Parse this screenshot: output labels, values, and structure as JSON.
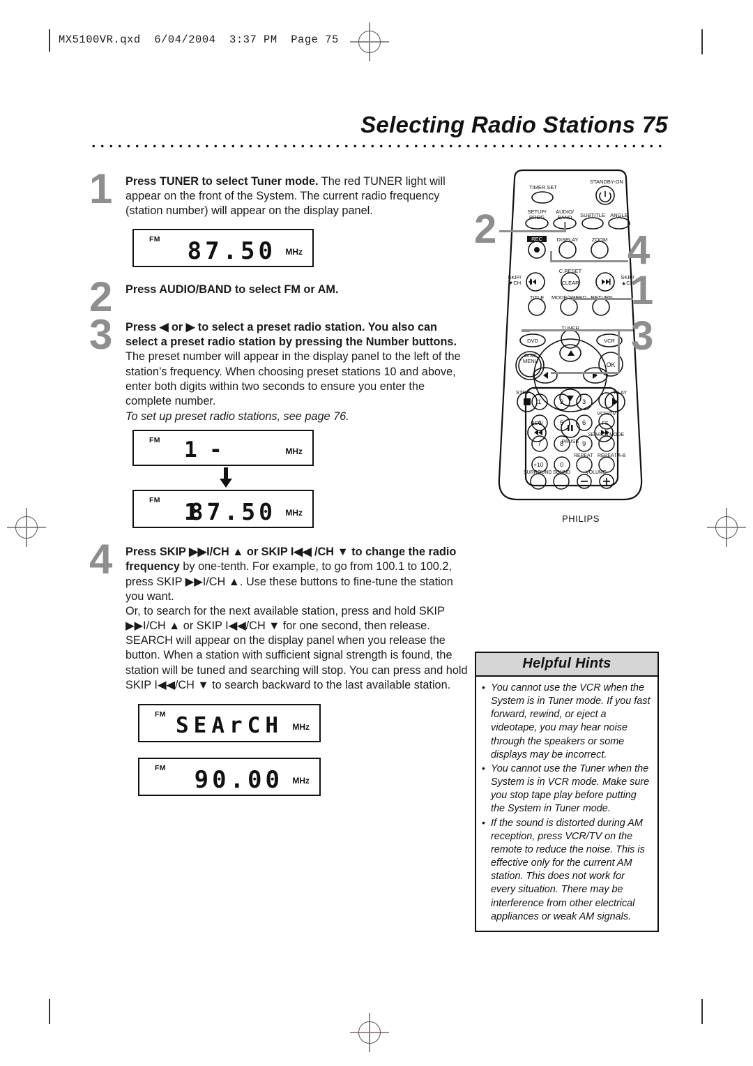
{
  "header": {
    "file_line": "MX5100VR.qxd  6/04/2004  3:37 PM  Page 75"
  },
  "title": {
    "text": "Selecting Radio Stations  75"
  },
  "steps": [
    {
      "num": "1",
      "bold": "Press TUNER to select Tuner mode.",
      "rest": " The red TUNER light will appear on the front of the System. The current radio frequency (station number) will appear on the display panel."
    },
    {
      "num": "2",
      "bold": "Press AUDIO/BAND to select FM or AM.",
      "rest": ""
    },
    {
      "num": "3",
      "bold": "Press ◀ or ▶ to select a preset radio station. You also can select a preset radio station by pressing the Number buttons.",
      "rest": " The preset number will appear in the display panel to the left of the station’s frequency. When choosing preset stations 10 and above, enter both digits within two seconds to ensure you enter the complete number.",
      "italic_note": "To set up preset radio stations, see page 76."
    },
    {
      "num": "4",
      "bold": "Press SKIP ▶▶I/CH ▲ or SKIP I◀◀ /CH ▼ to change the radio frequency",
      "rest": " by one-tenth. For example, to go from 100.1 to 100.2, press SKIP ▶▶I/CH ▲. Use these buttons to fine-tune the station you want.",
      "rest2": "Or, to search for the next available station, press and hold SKIP ▶▶I/CH ▲ or SKIP I◀◀/CH ▼ for one second, then release. SEARCH will appear on the display panel when you release the button. When a station with sufficient signal strength is found, the station will be tuned and searching will stop. You can press and hold SKIP I◀◀/CH ▼ to search backward to the last available station."
    }
  ],
  "displays": [
    {
      "id": "display-1",
      "band": "FM",
      "preset": "",
      "value": "87.50",
      "unit": "MHz"
    },
    {
      "id": "display-2",
      "band": "FM",
      "preset": "1",
      "value": "-",
      "unit": "MHz"
    },
    {
      "id": "display-3",
      "band": "FM",
      "preset": "1",
      "value": "87.50",
      "unit": "MHz"
    },
    {
      "id": "display-4",
      "band": "FM",
      "preset": "",
      "value": "SEArCH",
      "unit": "MHz"
    },
    {
      "id": "display-5",
      "band": "FM",
      "preset": "",
      "value": "90.00",
      "unit": "MHz"
    }
  ],
  "hints": {
    "caption": "Helpful Hints",
    "items": [
      "You cannot use the VCR when the System is in Tuner mode. If you fast forward, rewind, or eject a videotape, you may hear noise through the speakers or some displays may be incorrect.",
      "You cannot use the Tuner when the System is in VCR mode. Make sure you stop tape play before putting the System in Tuner mode.",
      "If the sound is distorted during AM reception, press VCR/TV on the remote to reduce the noise. This is effective only for the current AM station. This does not work for every situation. There may be interference from other electrical appliances or weak AM signals."
    ]
  },
  "remote": {
    "brand": "PHILIPS",
    "callouts": [
      {
        "label": "2",
        "target": "audio-band-button"
      },
      {
        "label": "4",
        "target": "skip-forward-button"
      },
      {
        "label": "1",
        "target": "tuner-button"
      },
      {
        "label": "3",
        "target": "arrow-left-right-buttons"
      }
    ],
    "buttons": [
      {
        "label": "TIMER SET"
      },
      {
        "label": "STANDBY-ON"
      },
      {
        "label": "SETUP/ PROG"
      },
      {
        "label": "AUDIO/ BAND"
      },
      {
        "label": "SUBTITLE"
      },
      {
        "label": "ANGLE"
      },
      {
        "label": "REC"
      },
      {
        "label": "DISPLAY"
      },
      {
        "label": "ZOOM"
      },
      {
        "label": "SKIP/ ▼CH"
      },
      {
        "label": "C.RESET"
      },
      {
        "label": "CLEAR"
      },
      {
        "label": "SKIP/ ▲CH"
      },
      {
        "label": "TITLE"
      },
      {
        "label": "MODE/SPEED"
      },
      {
        "label": "RETURN"
      },
      {
        "label": "TUNER"
      },
      {
        "label": "DVD"
      },
      {
        "label": "VCR"
      },
      {
        "label": "DISC MENU"
      },
      {
        "label": "OK"
      },
      {
        "label": "STOP"
      },
      {
        "label": "PLAY"
      },
      {
        "label": "REW"
      },
      {
        "label": "PAUSE"
      },
      {
        "label": "FF"
      },
      {
        "label": "1"
      },
      {
        "label": "2"
      },
      {
        "label": "3"
      },
      {
        "label": "4"
      },
      {
        "label": "5"
      },
      {
        "label": "6"
      },
      {
        "label": "7"
      },
      {
        "label": "8"
      },
      {
        "label": "9"
      },
      {
        "label": "+10"
      },
      {
        "label": "0"
      },
      {
        "label": "VCR/TV"
      },
      {
        "label": "SEARCH MODE"
      },
      {
        "label": "REPEAT"
      },
      {
        "label": "REPEAT A-B"
      },
      {
        "label": "SURROUND"
      },
      {
        "label": "SOUND"
      },
      {
        "label": "VOLUME"
      }
    ]
  }
}
